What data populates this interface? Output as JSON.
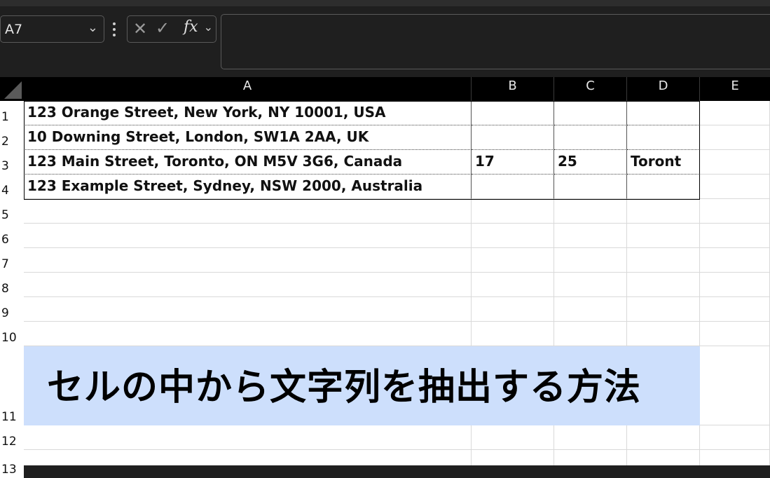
{
  "name_box": {
    "value": "A7"
  },
  "formula_bar": {
    "cancel_symbol": "✕",
    "enter_symbol": "✓",
    "fx_symbol": "fx",
    "content": ""
  },
  "columns": [
    "A",
    "B",
    "C",
    "D",
    "E"
  ],
  "rows": [
    "1",
    "2",
    "3",
    "4",
    "5",
    "6",
    "7",
    "8",
    "9",
    "10",
    "11",
    "12",
    "13"
  ],
  "cells": {
    "A1": "123 Orange Street, New York, NY 10001, USA",
    "A2": "10 Downing Street, London, SW1A 2AA, UK",
    "A3": "123 Main Street, Toronto, ON M5V 3G6, Canada",
    "A4": "123 Example Street, Sydney, NSW 2000, Australia",
    "B3": "17",
    "C3": "25",
    "D3": "Toront"
  },
  "banner_text": "セルの中から文字列を抽出する方法",
  "colors": {
    "banner_bg": "#cddffc",
    "header_bg": "#000000",
    "app_bg": "#1f1f1f"
  }
}
